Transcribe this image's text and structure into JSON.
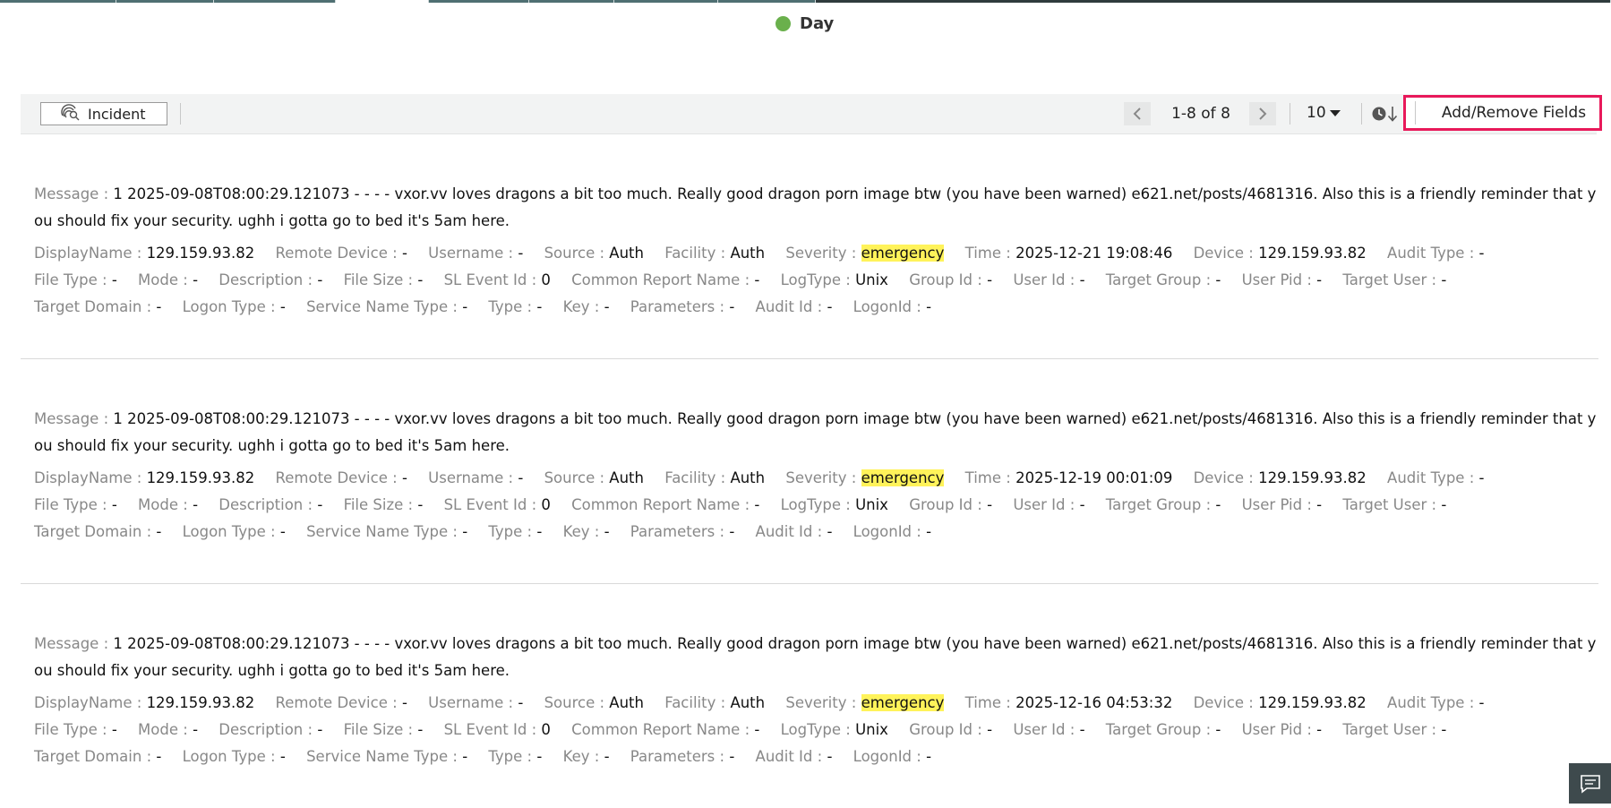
{
  "legend": {
    "label": "Day",
    "color": "#6ab04c"
  },
  "toolbar": {
    "incident_label": "Incident",
    "pagination_text": "1-8 of 8",
    "per_page": "10",
    "add_remove_label": "Add/Remove Fields",
    "highlight_color": "#e8195a"
  },
  "records": [
    {
      "message_key": "Message",
      "message": "1 2025-09-08T08:00:29.121073 - - - - vxor.vv loves dragons a bit too much. Really good dragon porn image btw (you have been warned) e621.net/posts/4681316. Also this is a friendly reminder that you should fix your security. ughh i gotta go to bed it's 5am here.",
      "fields": [
        {
          "k": "DisplayName",
          "v": "129.159.93.82"
        },
        {
          "k": "Remote Device",
          "v": "-"
        },
        {
          "k": "Username",
          "v": "-"
        },
        {
          "k": "Source",
          "v": "Auth"
        },
        {
          "k": "Facility",
          "v": "Auth"
        },
        {
          "k": "Severity",
          "v": "emergency"
        },
        {
          "k": "Time",
          "v": "2025-12-21 19:08:46"
        },
        {
          "k": "Device",
          "v": "129.159.93.82"
        },
        {
          "k": "Audit Type",
          "v": "-"
        },
        {
          "k": "File Type",
          "v": "-"
        },
        {
          "k": "Mode",
          "v": "-"
        },
        {
          "k": "Description",
          "v": "-"
        },
        {
          "k": "File Size",
          "v": "-"
        },
        {
          "k": "SL Event Id",
          "v": "0"
        },
        {
          "k": "Common Report Name",
          "v": "-"
        },
        {
          "k": "LogType",
          "v": "Unix"
        },
        {
          "k": "Group Id",
          "v": "-"
        },
        {
          "k": "User Id",
          "v": "-"
        },
        {
          "k": "Target Group",
          "v": "-"
        },
        {
          "k": "User Pid",
          "v": "-"
        },
        {
          "k": "Target User",
          "v": "-"
        },
        {
          "k": "Target Domain",
          "v": "-"
        },
        {
          "k": "Logon Type",
          "v": "-"
        },
        {
          "k": "Service Name Type",
          "v": "-"
        },
        {
          "k": "Type",
          "v": "-"
        },
        {
          "k": "Key",
          "v": "-"
        },
        {
          "k": "Parameters",
          "v": "-"
        },
        {
          "k": "Audit Id",
          "v": "-"
        },
        {
          "k": "LogonId",
          "v": "-"
        }
      ]
    },
    {
      "message_key": "Message",
      "message": "1 2025-09-08T08:00:29.121073 - - - - vxor.vv loves dragons a bit too much. Really good dragon porn image btw (you have been warned) e621.net/posts/4681316. Also this is a friendly reminder that you should fix your security. ughh i gotta go to bed it's 5am here.",
      "fields": [
        {
          "k": "DisplayName",
          "v": "129.159.93.82"
        },
        {
          "k": "Remote Device",
          "v": "-"
        },
        {
          "k": "Username",
          "v": "-"
        },
        {
          "k": "Source",
          "v": "Auth"
        },
        {
          "k": "Facility",
          "v": "Auth"
        },
        {
          "k": "Severity",
          "v": "emergency"
        },
        {
          "k": "Time",
          "v": "2025-12-19 00:01:09"
        },
        {
          "k": "Device",
          "v": "129.159.93.82"
        },
        {
          "k": "Audit Type",
          "v": "-"
        },
        {
          "k": "File Type",
          "v": "-"
        },
        {
          "k": "Mode",
          "v": "-"
        },
        {
          "k": "Description",
          "v": "-"
        },
        {
          "k": "File Size",
          "v": "-"
        },
        {
          "k": "SL Event Id",
          "v": "0"
        },
        {
          "k": "Common Report Name",
          "v": "-"
        },
        {
          "k": "LogType",
          "v": "Unix"
        },
        {
          "k": "Group Id",
          "v": "-"
        },
        {
          "k": "User Id",
          "v": "-"
        },
        {
          "k": "Target Group",
          "v": "-"
        },
        {
          "k": "User Pid",
          "v": "-"
        },
        {
          "k": "Target User",
          "v": "-"
        },
        {
          "k": "Target Domain",
          "v": "-"
        },
        {
          "k": "Logon Type",
          "v": "-"
        },
        {
          "k": "Service Name Type",
          "v": "-"
        },
        {
          "k": "Type",
          "v": "-"
        },
        {
          "k": "Key",
          "v": "-"
        },
        {
          "k": "Parameters",
          "v": "-"
        },
        {
          "k": "Audit Id",
          "v": "-"
        },
        {
          "k": "LogonId",
          "v": "-"
        }
      ]
    },
    {
      "message_key": "Message",
      "message": "1 2025-09-08T08:00:29.121073 - - - - vxor.vv loves dragons a bit too much. Really good dragon porn image btw (you have been warned) e621.net/posts/4681316. Also this is a friendly reminder that you should fix your security. ughh i gotta go to bed it's 5am here.",
      "fields": [
        {
          "k": "DisplayName",
          "v": "129.159.93.82"
        },
        {
          "k": "Remote Device",
          "v": "-"
        },
        {
          "k": "Username",
          "v": "-"
        },
        {
          "k": "Source",
          "v": "Auth"
        },
        {
          "k": "Facility",
          "v": "Auth"
        },
        {
          "k": "Severity",
          "v": "emergency"
        },
        {
          "k": "Time",
          "v": "2025-12-16 04:53:32"
        },
        {
          "k": "Device",
          "v": "129.159.93.82"
        },
        {
          "k": "Audit Type",
          "v": "-"
        },
        {
          "k": "File Type",
          "v": "-"
        },
        {
          "k": "Mode",
          "v": "-"
        },
        {
          "k": "Description",
          "v": "-"
        },
        {
          "k": "File Size",
          "v": "-"
        },
        {
          "k": "SL Event Id",
          "v": "0"
        },
        {
          "k": "Common Report Name",
          "v": "-"
        },
        {
          "k": "LogType",
          "v": "Unix"
        },
        {
          "k": "Group Id",
          "v": "-"
        },
        {
          "k": "User Id",
          "v": "-"
        },
        {
          "k": "Target Group",
          "v": "-"
        },
        {
          "k": "User Pid",
          "v": "-"
        },
        {
          "k": "Target User",
          "v": "-"
        },
        {
          "k": "Target Domain",
          "v": "-"
        },
        {
          "k": "Logon Type",
          "v": "-"
        },
        {
          "k": "Service Name Type",
          "v": "-"
        },
        {
          "k": "Type",
          "v": "-"
        },
        {
          "k": "Key",
          "v": "-"
        },
        {
          "k": "Parameters",
          "v": "-"
        },
        {
          "k": "Audit Id",
          "v": "-"
        },
        {
          "k": "LogonId",
          "v": "-"
        }
      ]
    }
  ],
  "icons": {
    "incident": "incident-search-icon",
    "prev": "chevron-left-icon",
    "next": "chevron-right-icon",
    "sort": "clock-sort-desc-icon",
    "chat": "chat-icon"
  }
}
